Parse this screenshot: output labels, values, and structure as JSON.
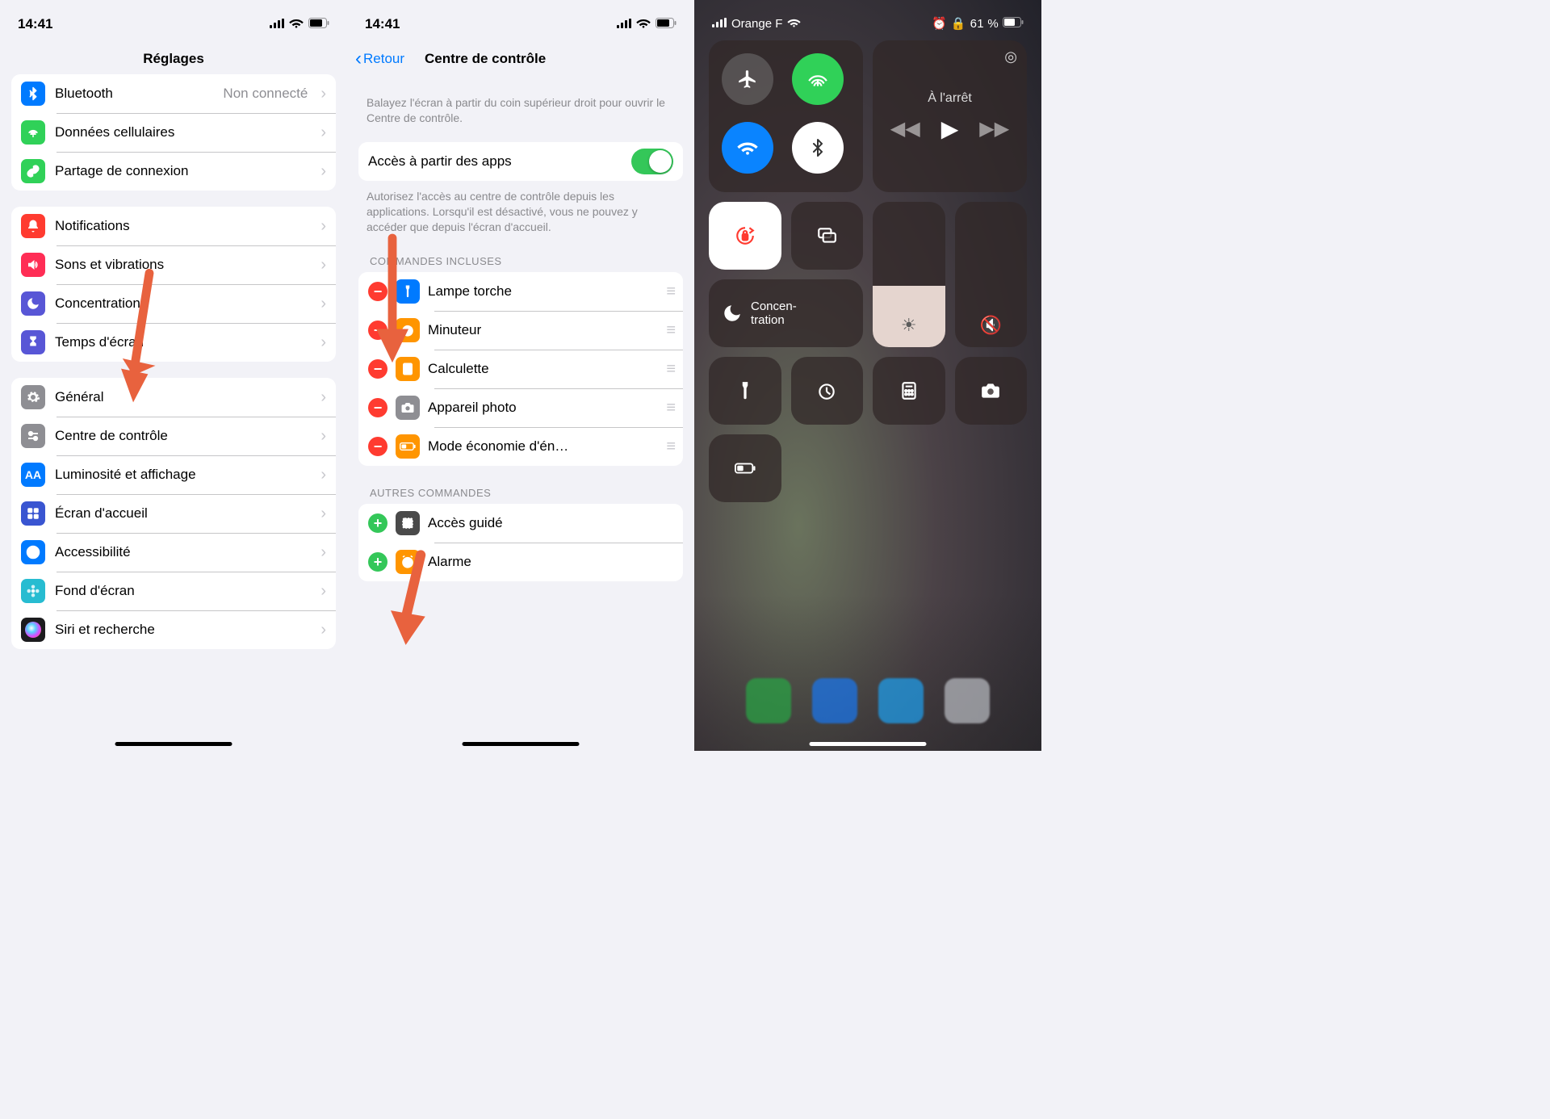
{
  "screen1": {
    "time": "14:41",
    "title": "Réglages",
    "rows": [
      {
        "k": "bluetooth",
        "label": "Bluetooth",
        "value": "Non connecté",
        "bg": "#007aff",
        "icon": "bt"
      },
      {
        "k": "cellular",
        "label": "Données cellulaires",
        "bg": "#30d158",
        "icon": "antenna"
      },
      {
        "k": "hotspot",
        "label": "Partage de connexion",
        "bg": "#30d158",
        "icon": "link"
      }
    ],
    "rows2": [
      {
        "k": "notifications",
        "label": "Notifications",
        "bg": "#ff3b30",
        "icon": "bell"
      },
      {
        "k": "sounds",
        "label": "Sons et vibrations",
        "bg": "#ff2d55",
        "icon": "speaker"
      },
      {
        "k": "focus",
        "label": "Concentration",
        "bg": "#5856d6",
        "icon": "moon"
      },
      {
        "k": "screentime",
        "label": "Temps d'écran",
        "bg": "#5856d6",
        "icon": "hourglass"
      }
    ],
    "rows3": [
      {
        "k": "general",
        "label": "Général",
        "bg": "#8e8e93",
        "icon": "gear"
      },
      {
        "k": "controlcenter",
        "label": "Centre de contrôle",
        "bg": "#8e8e93",
        "icon": "switches"
      },
      {
        "k": "display",
        "label": "Luminosité et affichage",
        "bg": "#007aff",
        "icon": "aa"
      },
      {
        "k": "home",
        "label": "Écran d'accueil",
        "bg": "#3955d1",
        "icon": "grid"
      },
      {
        "k": "accessibility",
        "label": "Accessibilité",
        "bg": "#007aff",
        "icon": "person"
      },
      {
        "k": "wallpaper",
        "label": "Fond d'écran",
        "bg": "#27bcd1",
        "icon": "flower"
      },
      {
        "k": "siri",
        "label": "Siri et recherche",
        "bg": "#1c1c1e",
        "icon": "siri"
      }
    ]
  },
  "screen2": {
    "time": "14:41",
    "back": "Retour",
    "title": "Centre de contrôle",
    "intro": "Balayez l'écran à partir du coin supérieur droit pour ouvrir le Centre de contrôle.",
    "access_label": "Accès à partir des apps",
    "access_on": true,
    "access_desc": "Autorisez l'accès au centre de contrôle depuis les applications. Lorsqu'il est désactivé, vous ne pouvez y accéder que depuis l'écran d'accueil.",
    "included_title": "COMMANDES INCLUSES",
    "included": [
      {
        "k": "torch",
        "label": "Lampe torche",
        "bg": "#007aff",
        "icon": "torch"
      },
      {
        "k": "timer",
        "label": "Minuteur",
        "bg": "#ff9500",
        "icon": "timer"
      },
      {
        "k": "calc",
        "label": "Calculette",
        "bg": "#ff9500",
        "icon": "calc"
      },
      {
        "k": "camera",
        "label": "Appareil photo",
        "bg": "#8e8e93",
        "icon": "camera"
      },
      {
        "k": "lowpower",
        "label": "Mode économie d'én…",
        "bg": "#ff9500",
        "icon": "battery"
      }
    ],
    "more_title": "AUTRES COMMANDES",
    "more": [
      {
        "k": "guided",
        "label": "Accès guidé",
        "bg": "#4a4a4a",
        "icon": "lock"
      },
      {
        "k": "alarm",
        "label": "Alarme",
        "bg": "#ff9500",
        "icon": "alarm"
      }
    ]
  },
  "screen3": {
    "carrier": "Orange F",
    "battery": "61 %",
    "media_title": "À l'arrêt",
    "focus_label": "Concen-\ntration"
  }
}
